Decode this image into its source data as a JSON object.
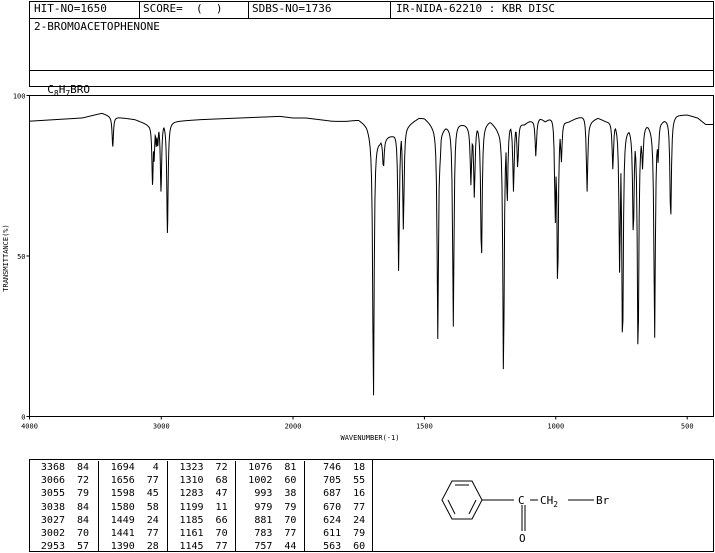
{
  "header": {
    "hit_no": "HIT-NO=1650",
    "score": "SCORE=  (  )",
    "sdbs_no": "SDBS-NO=1736",
    "ir_nida": "IR-NIDA-62210 : KBR DISC",
    "compound_name": "2-BROMOACETOPHENONE",
    "formula_c": "C",
    "formula_c_sub": "8",
    "formula_h": "H",
    "formula_h_sub": "7",
    "formula_rest": "BRO"
  },
  "chart_data": {
    "type": "line",
    "xlabel": "WAVENUMBER(-1)",
    "ylabel": "TRANSMITTANCE(%)",
    "xlim": [
      4000,
      400
    ],
    "ylim": [
      0,
      100
    ],
    "x_ticks": [
      "4000",
      "3000",
      "2000",
      "1500",
      "1000",
      "500"
    ],
    "y_ticks": [
      "100",
      "50",
      "0"
    ],
    "baseline": [
      [
        4000,
        92
      ],
      [
        3800,
        92.5
      ],
      [
        3600,
        93
      ],
      [
        3450,
        94.5
      ],
      [
        3380,
        93.5
      ],
      [
        3200,
        92.5
      ],
      [
        3100,
        91
      ],
      [
        2900,
        92
      ],
      [
        2700,
        92.5
      ],
      [
        2400,
        93
      ],
      [
        2100,
        93.5
      ],
      [
        2000,
        93
      ],
      [
        1950,
        93
      ],
      [
        1900,
        92.5
      ],
      [
        1850,
        92
      ],
      [
        1800,
        92
      ],
      [
        1750,
        92.5
      ],
      [
        1720,
        91
      ],
      [
        1700,
        88
      ],
      [
        1670,
        86
      ],
      [
        1640,
        87
      ],
      [
        1620,
        88
      ],
      [
        1600,
        90
      ],
      [
        1560,
        91
      ],
      [
        1520,
        93
      ],
      [
        1500,
        93
      ],
      [
        1470,
        91
      ],
      [
        1430,
        90
      ],
      [
        1400,
        91
      ],
      [
        1380,
        92
      ],
      [
        1350,
        91
      ],
      [
        1320,
        90
      ],
      [
        1300,
        91
      ],
      [
        1280,
        91
      ],
      [
        1250,
        92
      ],
      [
        1220,
        90
      ],
      [
        1180,
        91
      ],
      [
        1150,
        92
      ],
      [
        1120,
        91
      ],
      [
        1100,
        92
      ],
      [
        1060,
        93
      ],
      [
        1040,
        92
      ],
      [
        1010,
        94
      ],
      [
        980,
        92
      ],
      [
        950,
        92
      ],
      [
        920,
        93
      ],
      [
        890,
        94
      ],
      [
        870,
        92
      ],
      [
        840,
        93
      ],
      [
        810,
        92
      ],
      [
        790,
        92
      ],
      [
        760,
        91
      ],
      [
        730,
        90
      ],
      [
        700,
        89
      ],
      [
        680,
        89
      ],
      [
        650,
        91
      ],
      [
        620,
        90
      ],
      [
        600,
        92
      ],
      [
        570,
        93
      ],
      [
        540,
        94
      ],
      [
        500,
        94
      ],
      [
        460,
        93
      ],
      [
        430,
        91
      ],
      [
        400,
        91
      ]
    ],
    "peaks": [
      {
        "x": 3368,
        "y": 84
      },
      {
        "x": 3066,
        "y": 72
      },
      {
        "x": 3055,
        "y": 79
      },
      {
        "x": 3038,
        "y": 84
      },
      {
        "x": 3027,
        "y": 84
      },
      {
        "x": 3002,
        "y": 70
      },
      {
        "x": 2953,
        "y": 57
      },
      {
        "x": 1694,
        "y": 4
      },
      {
        "x": 1656,
        "y": 77
      },
      {
        "x": 1598,
        "y": 45
      },
      {
        "x": 1580,
        "y": 58
      },
      {
        "x": 1449,
        "y": 24
      },
      {
        "x": 1441,
        "y": 77
      },
      {
        "x": 1390,
        "y": 28
      },
      {
        "x": 1323,
        "y": 72
      },
      {
        "x": 1310,
        "y": 68
      },
      {
        "x": 1283,
        "y": 47
      },
      {
        "x": 1199,
        "y": 11
      },
      {
        "x": 1185,
        "y": 66
      },
      {
        "x": 1161,
        "y": 70
      },
      {
        "x": 1145,
        "y": 77
      },
      {
        "x": 1076,
        "y": 81
      },
      {
        "x": 1002,
        "y": 60
      },
      {
        "x": 993,
        "y": 38
      },
      {
        "x": 979,
        "y": 79
      },
      {
        "x": 881,
        "y": 70
      },
      {
        "x": 783,
        "y": 77
      },
      {
        "x": 757,
        "y": 44
      },
      {
        "x": 746,
        "y": 18
      },
      {
        "x": 705,
        "y": 55
      },
      {
        "x": 687,
        "y": 16
      },
      {
        "x": 670,
        "y": 77
      },
      {
        "x": 624,
        "y": 24
      },
      {
        "x": 611,
        "y": 79
      },
      {
        "x": 563,
        "y": 60
      }
    ]
  },
  "peak_table": {
    "columns": [
      [
        [
          "3368",
          "84"
        ],
        [
          "3066",
          "72"
        ],
        [
          "3055",
          "79"
        ],
        [
          "3038",
          "84"
        ],
        [
          "3027",
          "84"
        ],
        [
          "3002",
          "70"
        ],
        [
          "2953",
          "57"
        ]
      ],
      [
        [
          "1694",
          "4"
        ],
        [
          "1656",
          "77"
        ],
        [
          "1598",
          "45"
        ],
        [
          "1580",
          "58"
        ],
        [
          "1449",
          "24"
        ],
        [
          "1441",
          "77"
        ],
        [
          "1390",
          "28"
        ]
      ],
      [
        [
          "1323",
          "72"
        ],
        [
          "1310",
          "68"
        ],
        [
          "1283",
          "47"
        ],
        [
          "1199",
          "11"
        ],
        [
          "1185",
          "66"
        ],
        [
          "1161",
          "70"
        ],
        [
          "1145",
          "77"
        ]
      ],
      [
        [
          "1076",
          "81"
        ],
        [
          "1002",
          "60"
        ],
        [
          "993",
          "38"
        ],
        [
          "979",
          "79"
        ],
        [
          "881",
          "70"
        ],
        [
          "783",
          "77"
        ],
        [
          "757",
          "44"
        ]
      ],
      [
        [
          "746",
          "18"
        ],
        [
          "705",
          "55"
        ],
        [
          "687",
          "16"
        ],
        [
          "670",
          "77"
        ],
        [
          "624",
          "24"
        ],
        [
          "611",
          "79"
        ],
        [
          "563",
          "60"
        ]
      ]
    ]
  },
  "structure": {
    "carbonyl_c": "C",
    "ch2_c": "CH",
    "ch2_sub": "2",
    "bromine": "Br",
    "oxygen": "O"
  }
}
